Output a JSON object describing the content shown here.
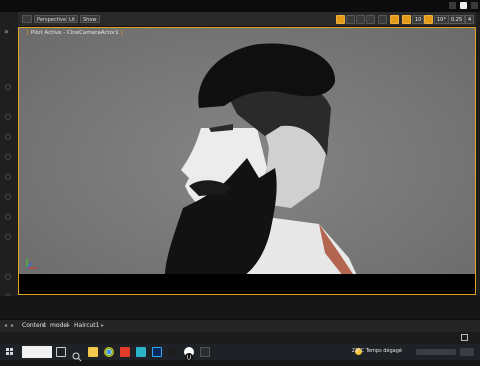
{
  "toolbar": {
    "view_mode_label": "Perspective",
    "lit_label": "Lit",
    "show_label": "Show",
    "grid_value": "10",
    "angle_value": "10°",
    "scale_value": "0.25",
    "cam_speed": "4"
  },
  "viewport": {
    "pilot_text": "Pilot Active - CineCameraActor1"
  },
  "breadcrumb": {
    "items": [
      "Content",
      "model",
      "Haircut1"
    ]
  },
  "taskbar": {
    "weather": "23°C  Temps dégagé"
  },
  "colors": {
    "accent": "#e2a41c",
    "viewport_bg": "#787878"
  }
}
